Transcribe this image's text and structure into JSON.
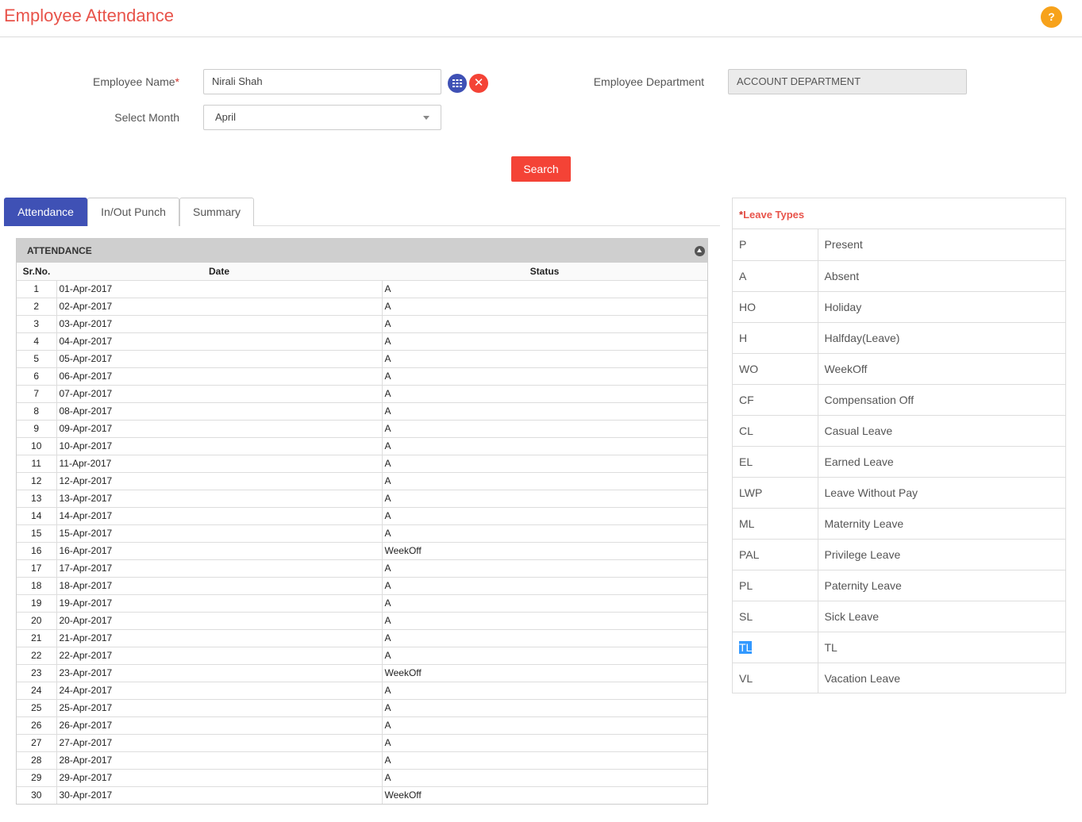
{
  "header": {
    "title": "Employee Attendance",
    "help_label": "?"
  },
  "form": {
    "employee_name_label": "Employee Name",
    "required_mark": "*",
    "employee_name_value": "Nirali  Shah",
    "select_month_label": "Select Month",
    "select_month_value": "April",
    "department_label": "Employee Department",
    "department_value": "ACCOUNT DEPARTMENT",
    "search_label": "Search"
  },
  "tabs": [
    {
      "label": "Attendance",
      "active": true
    },
    {
      "label": "In/Out Punch",
      "active": false
    },
    {
      "label": "Summary",
      "active": false
    }
  ],
  "attendance": {
    "title": "ATTENDANCE",
    "columns": [
      "Sr.No.",
      "Date",
      "Status"
    ],
    "rows": [
      [
        "1",
        "01-Apr-2017",
        "A"
      ],
      [
        "2",
        "02-Apr-2017",
        "A"
      ],
      [
        "3",
        "03-Apr-2017",
        "A"
      ],
      [
        "4",
        "04-Apr-2017",
        "A"
      ],
      [
        "5",
        "05-Apr-2017",
        "A"
      ],
      [
        "6",
        "06-Apr-2017",
        "A"
      ],
      [
        "7",
        "07-Apr-2017",
        "A"
      ],
      [
        "8",
        "08-Apr-2017",
        "A"
      ],
      [
        "9",
        "09-Apr-2017",
        "A"
      ],
      [
        "10",
        "10-Apr-2017",
        "A"
      ],
      [
        "11",
        "11-Apr-2017",
        "A"
      ],
      [
        "12",
        "12-Apr-2017",
        "A"
      ],
      [
        "13",
        "13-Apr-2017",
        "A"
      ],
      [
        "14",
        "14-Apr-2017",
        "A"
      ],
      [
        "15",
        "15-Apr-2017",
        "A"
      ],
      [
        "16",
        "16-Apr-2017",
        "WeekOff"
      ],
      [
        "17",
        "17-Apr-2017",
        "A"
      ],
      [
        "18",
        "18-Apr-2017",
        "A"
      ],
      [
        "19",
        "19-Apr-2017",
        "A"
      ],
      [
        "20",
        "20-Apr-2017",
        "A"
      ],
      [
        "21",
        "21-Apr-2017",
        "A"
      ],
      [
        "22",
        "22-Apr-2017",
        "A"
      ],
      [
        "23",
        "23-Apr-2017",
        "WeekOff"
      ],
      [
        "24",
        "24-Apr-2017",
        "A"
      ],
      [
        "25",
        "25-Apr-2017",
        "A"
      ],
      [
        "26",
        "26-Apr-2017",
        "A"
      ],
      [
        "27",
        "27-Apr-2017",
        "A"
      ],
      [
        "28",
        "28-Apr-2017",
        "A"
      ],
      [
        "29",
        "29-Apr-2017",
        "A"
      ],
      [
        "30",
        "30-Apr-2017",
        "WeekOff"
      ]
    ]
  },
  "leave_types": {
    "title_star": "*",
    "title": "Leave Types",
    "rows": [
      [
        "P",
        "Present"
      ],
      [
        "A",
        "Absent"
      ],
      [
        "HO",
        "Holiday"
      ],
      [
        "H",
        "Halfday(Leave)"
      ],
      [
        "WO",
        "WeekOff"
      ],
      [
        "CF",
        "Compensation Off"
      ],
      [
        "CL",
        "Casual Leave"
      ],
      [
        "EL",
        "Earned Leave"
      ],
      [
        "LWP",
        "Leave Without Pay"
      ],
      [
        "ML",
        "Maternity Leave"
      ],
      [
        "PAL",
        "Privilege Leave"
      ],
      [
        "PL",
        "Paternity Leave"
      ],
      [
        "SL",
        "Sick Leave"
      ],
      [
        "TL",
        "TL"
      ],
      [
        "VL",
        "Vacation Leave"
      ]
    ],
    "selected_code": "TL"
  },
  "icons": {
    "list": "list-icon",
    "clear": "close-icon",
    "dropdown": "chevron-down-icon",
    "collapse": "collapse-icon"
  },
  "colors": {
    "title": "#e8534a",
    "primary": "#3f51b5",
    "danger": "#f44336",
    "help": "#f7a21b",
    "selection": "#3399ff"
  }
}
